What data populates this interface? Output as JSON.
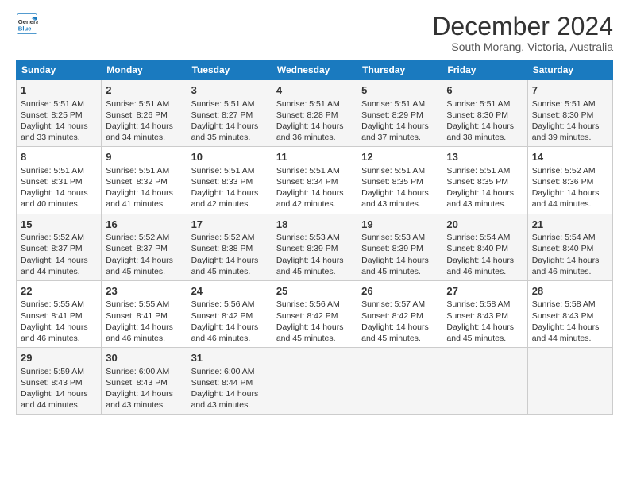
{
  "logo": {
    "line1": "General",
    "line2": "Blue"
  },
  "title": "December 2024",
  "subtitle": "South Morang, Victoria, Australia",
  "days_header": [
    "Sunday",
    "Monday",
    "Tuesday",
    "Wednesday",
    "Thursday",
    "Friday",
    "Saturday"
  ],
  "weeks": [
    [
      {
        "day": "1",
        "rise": "5:51 AM",
        "set": "8:25 PM",
        "hours": "14 hours",
        "mins": "33 minutes"
      },
      {
        "day": "2",
        "rise": "5:51 AM",
        "set": "8:26 PM",
        "hours": "14 hours",
        "mins": "34 minutes"
      },
      {
        "day": "3",
        "rise": "5:51 AM",
        "set": "8:27 PM",
        "hours": "14 hours",
        "mins": "35 minutes"
      },
      {
        "day": "4",
        "rise": "5:51 AM",
        "set": "8:28 PM",
        "hours": "14 hours",
        "mins": "36 minutes"
      },
      {
        "day": "5",
        "rise": "5:51 AM",
        "set": "8:29 PM",
        "hours": "14 hours",
        "mins": "37 minutes"
      },
      {
        "day": "6",
        "rise": "5:51 AM",
        "set": "8:30 PM",
        "hours": "14 hours",
        "mins": "38 minutes"
      },
      {
        "day": "7",
        "rise": "5:51 AM",
        "set": "8:30 PM",
        "hours": "14 hours",
        "mins": "39 minutes"
      }
    ],
    [
      {
        "day": "8",
        "rise": "5:51 AM",
        "set": "8:31 PM",
        "hours": "14 hours",
        "mins": "40 minutes"
      },
      {
        "day": "9",
        "rise": "5:51 AM",
        "set": "8:32 PM",
        "hours": "14 hours",
        "mins": "41 minutes"
      },
      {
        "day": "10",
        "rise": "5:51 AM",
        "set": "8:33 PM",
        "hours": "14 hours",
        "mins": "42 minutes"
      },
      {
        "day": "11",
        "rise": "5:51 AM",
        "set": "8:34 PM",
        "hours": "14 hours",
        "mins": "42 minutes"
      },
      {
        "day": "12",
        "rise": "5:51 AM",
        "set": "8:35 PM",
        "hours": "14 hours",
        "mins": "43 minutes"
      },
      {
        "day": "13",
        "rise": "5:51 AM",
        "set": "8:35 PM",
        "hours": "14 hours",
        "mins": "43 minutes"
      },
      {
        "day": "14",
        "rise": "5:52 AM",
        "set": "8:36 PM",
        "hours": "14 hours",
        "mins": "44 minutes"
      }
    ],
    [
      {
        "day": "15",
        "rise": "5:52 AM",
        "set": "8:37 PM",
        "hours": "14 hours",
        "mins": "44 minutes"
      },
      {
        "day": "16",
        "rise": "5:52 AM",
        "set": "8:37 PM",
        "hours": "14 hours",
        "mins": "45 minutes"
      },
      {
        "day": "17",
        "rise": "5:52 AM",
        "set": "8:38 PM",
        "hours": "14 hours",
        "mins": "45 minutes"
      },
      {
        "day": "18",
        "rise": "5:53 AM",
        "set": "8:39 PM",
        "hours": "14 hours",
        "mins": "45 minutes"
      },
      {
        "day": "19",
        "rise": "5:53 AM",
        "set": "8:39 PM",
        "hours": "14 hours",
        "mins": "45 minutes"
      },
      {
        "day": "20",
        "rise": "5:54 AM",
        "set": "8:40 PM",
        "hours": "14 hours",
        "mins": "46 minutes"
      },
      {
        "day": "21",
        "rise": "5:54 AM",
        "set": "8:40 PM",
        "hours": "14 hours",
        "mins": "46 minutes"
      }
    ],
    [
      {
        "day": "22",
        "rise": "5:55 AM",
        "set": "8:41 PM",
        "hours": "14 hours",
        "mins": "46 minutes"
      },
      {
        "day": "23",
        "rise": "5:55 AM",
        "set": "8:41 PM",
        "hours": "14 hours",
        "mins": "46 minutes"
      },
      {
        "day": "24",
        "rise": "5:56 AM",
        "set": "8:42 PM",
        "hours": "14 hours",
        "mins": "46 minutes"
      },
      {
        "day": "25",
        "rise": "5:56 AM",
        "set": "8:42 PM",
        "hours": "14 hours",
        "mins": "45 minutes"
      },
      {
        "day": "26",
        "rise": "5:57 AM",
        "set": "8:42 PM",
        "hours": "14 hours",
        "mins": "45 minutes"
      },
      {
        "day": "27",
        "rise": "5:58 AM",
        "set": "8:43 PM",
        "hours": "14 hours",
        "mins": "45 minutes"
      },
      {
        "day": "28",
        "rise": "5:58 AM",
        "set": "8:43 PM",
        "hours": "14 hours",
        "mins": "44 minutes"
      }
    ],
    [
      {
        "day": "29",
        "rise": "5:59 AM",
        "set": "8:43 PM",
        "hours": "14 hours",
        "mins": "44 minutes"
      },
      {
        "day": "30",
        "rise": "6:00 AM",
        "set": "8:43 PM",
        "hours": "14 hours",
        "mins": "43 minutes"
      },
      {
        "day": "31",
        "rise": "6:00 AM",
        "set": "8:44 PM",
        "hours": "14 hours",
        "mins": "43 minutes"
      },
      null,
      null,
      null,
      null
    ]
  ],
  "labels": {
    "sunrise": "Sunrise:",
    "sunset": "Sunset:",
    "daylight": "Daylight:"
  }
}
